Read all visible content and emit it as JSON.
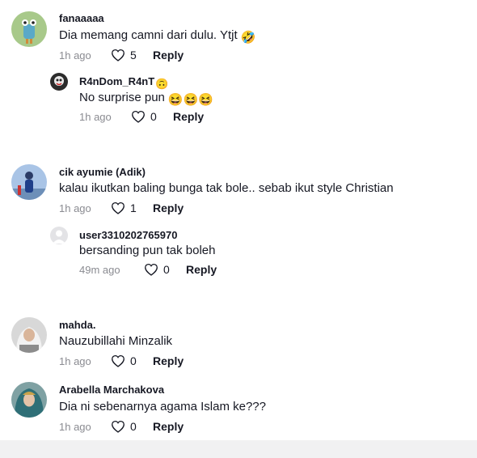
{
  "comments": [
    {
      "username": "fanaaaaa",
      "text": "Dia memang camni dari dulu. Ytjt",
      "emoji": "🤣",
      "time": "1h ago",
      "likes": "5",
      "reply_label": "Reply",
      "replies": [
        {
          "username": "R4nDom_R4nT",
          "username_emoji": "🙃",
          "text": "No surprise pun",
          "emoji": "😆😆😆",
          "time": "1h ago",
          "likes": "0",
          "reply_label": "Reply"
        }
      ]
    },
    {
      "username": "cik ayumie (Adik)",
      "text": "kalau ikutkan baling bunga tak bole.. sebab ikut style Christian",
      "time": "1h ago",
      "likes": "1",
      "reply_label": "Reply",
      "replies": [
        {
          "username": "user3310202765970",
          "text": "bersanding pun tak boleh",
          "time": "49m ago",
          "likes": "0",
          "reply_label": "Reply"
        }
      ]
    },
    {
      "username": "mahda.",
      "text": "Nauzubillahi Minzalik",
      "time": "1h ago",
      "likes": "0",
      "reply_label": "Reply"
    },
    {
      "username": "Arabella Marchakova",
      "text": "Dia ni sebenarnya agama Islam ke???",
      "time": "1h ago",
      "likes": "0",
      "reply_label": "Reply"
    }
  ],
  "icons": {
    "like": "heart-outline-icon"
  },
  "colors": {
    "meta": "#8a8b91",
    "text": "#161823"
  }
}
